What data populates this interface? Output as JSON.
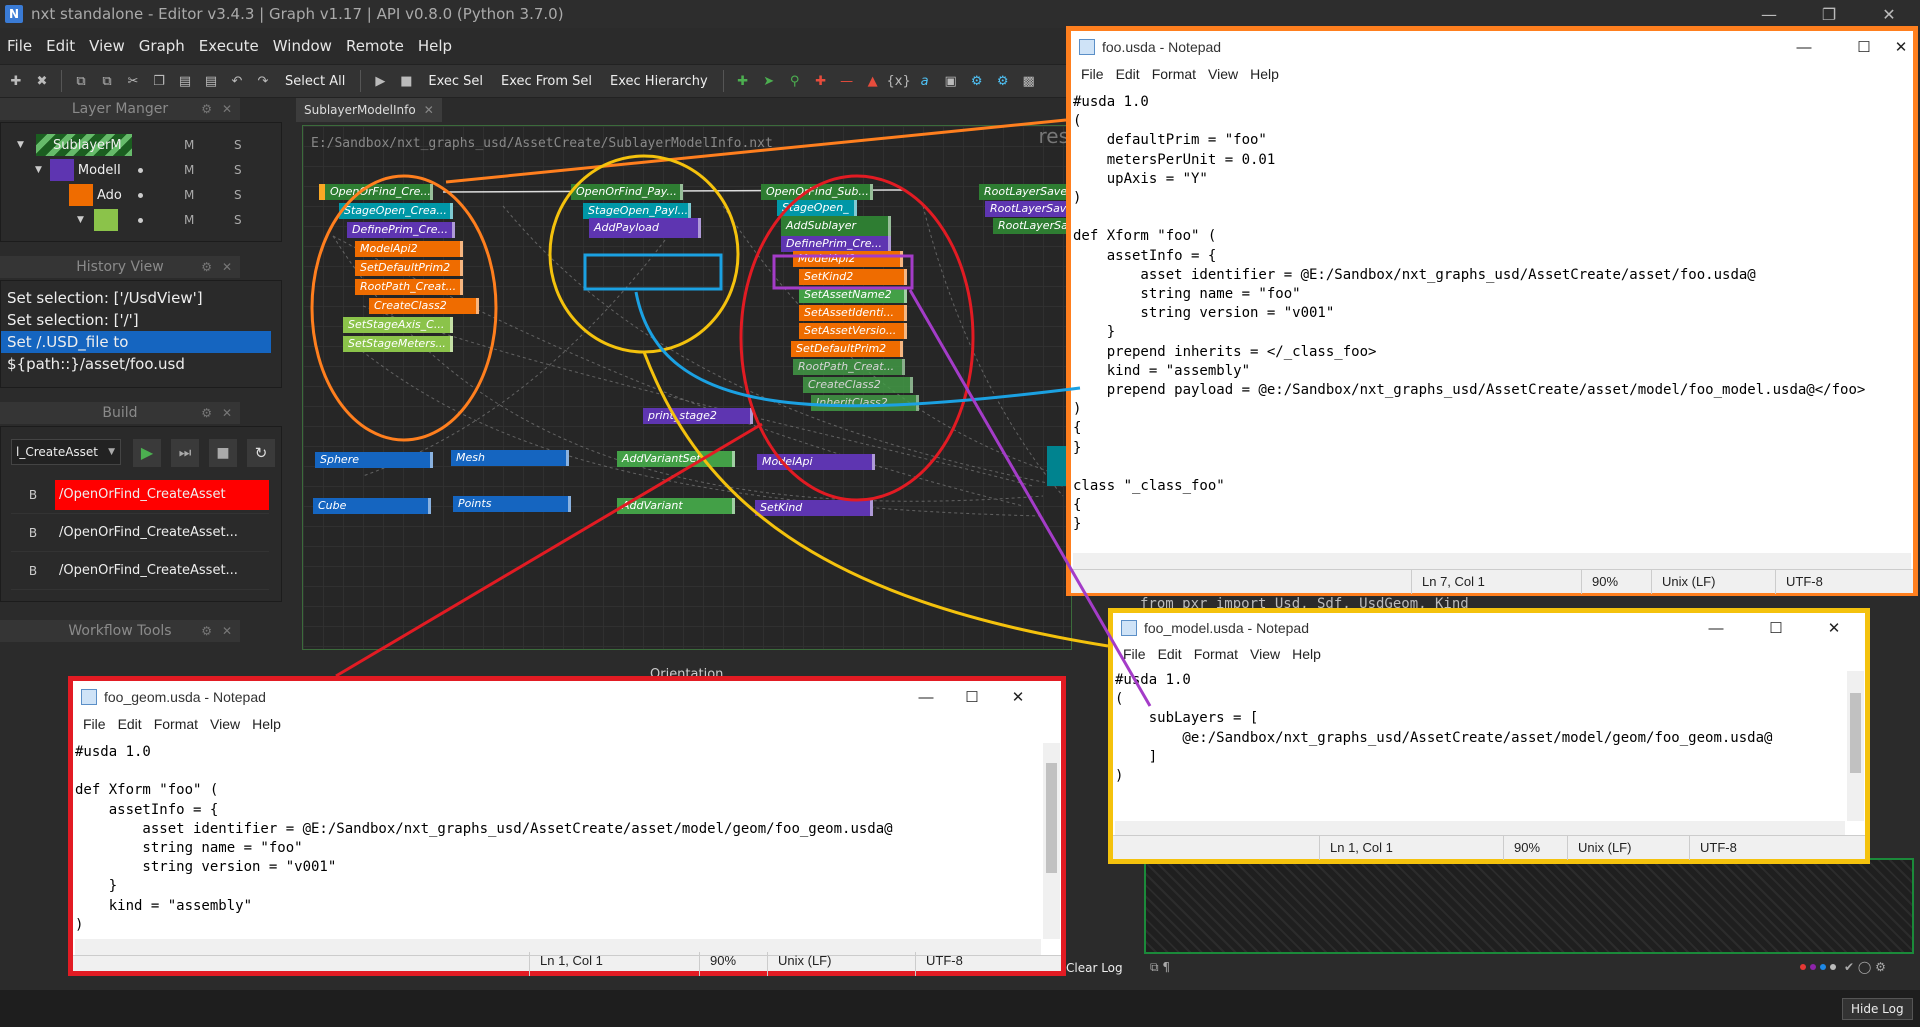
{
  "window": {
    "title": "nxt standalone - Editor v3.4.3 | Graph v1.17 | API v0.8.0 (Python 3.7.0)",
    "icon_letter": "N"
  },
  "menubar": [
    "File",
    "Edit",
    "View",
    "Graph",
    "Execute",
    "Window",
    "Remote",
    "Help"
  ],
  "toolbar": {
    "select_all": "Select All",
    "exec_sel": "Exec Sel",
    "exec_from_sel": "Exec From Sel",
    "exec_hierarchy": "Exec Hierarchy"
  },
  "layer_manager": {
    "title": "Layer Manger",
    "rows": [
      {
        "label": "SublayerM",
        "m": "M",
        "s": "S"
      },
      {
        "label": "ModelI",
        "m": "M",
        "s": "S"
      },
      {
        "label": "Ado",
        "m": "M",
        "s": "S"
      },
      {
        "label": "",
        "m": "M",
        "s": "S"
      }
    ]
  },
  "history_view": {
    "title": "History View",
    "items": [
      "Set selection: ['/UsdView']",
      "Set selection: ['/']",
      "Set /.USD_file to ${path::}/asset/foo.usd"
    ]
  },
  "build": {
    "title": "Build",
    "selected": "l_CreateAsset",
    "rows": [
      {
        "b": "B",
        "name": "/OpenOrFind_CreateAsset",
        "error": true
      },
      {
        "b": "B",
        "name": "/OpenOrFind_CreateAsset...",
        "error": false
      },
      {
        "b": "B",
        "name": "/OpenOrFind_CreateAsset...",
        "error": false
      }
    ]
  },
  "workflow_tools": {
    "title": "Workflow Tools"
  },
  "graph": {
    "tab": "SublayerModelInfo",
    "path": "E:/Sandbox/nxt_graphs_usd/AssetCreate/SublayerModelInfo.nxt",
    "corner_label": "res",
    "nodes": {
      "n1": "OpenOrFind_Cre...",
      "n2": "StageOpen_Crea...",
      "n3": "DefinePrim_Cre...",
      "n4": "ModelApi2",
      "n5": "SetDefaultPrim2",
      "n6": "RootPath_Creat...",
      "n7": "CreateClass2",
      "n8": "SetStageAxis_C...",
      "n9": "SetStageMeters...",
      "p1": "OpenOrFind_Pay...",
      "p2": "StageOpen_Payl...",
      "p3": "AddPayload",
      "s1": "OpenOrFind_Sub...",
      "s2": "StageOpen_",
      "s3": "AddSublayer",
      "s4": "DefinePrim_Cre...",
      "s5": "ModelApi2",
      "s6": "SetKind2",
      "s7": "SetAssetName2",
      "s8": "SetAssetIdenti...",
      "s9": "SetAssetVersio...",
      "s10": "SetDefaultPrim2",
      "s11": "RootPath_Creat...",
      "s12": "CreateClass2",
      "s13": "InheritClass2",
      "r1": "RootLayerSave",
      "r2": "RootLayerSav",
      "r3": "RootLayerSa",
      "print": "print_stage2",
      "sphere": "Sphere",
      "mesh": "Mesh",
      "addvariantset": "AddVariantSet",
      "modelapi": "ModelApi",
      "cube": "Cube",
      "points": "Points",
      "addvariant": "AddVariant",
      "setkind": "SetKind"
    }
  },
  "notepad_foo": {
    "title": "foo.usda - Notepad",
    "menu": [
      "File",
      "Edit",
      "Format",
      "View",
      "Help"
    ],
    "content": "#usda 1.0\n(\n    defaultPrim = \"foo\"\n    metersPerUnit = 0.01\n    upAxis = \"Y\"\n)\n\ndef Xform \"foo\" (\n    assetInfo = {\n        asset identifier = @E:/Sandbox/nxt_graphs_usd/AssetCreate/asset/foo.usda@\n        string name = \"foo\"\n        string version = \"v001\"\n    }\n    prepend inherits = </_class_foo>\n    kind = \"assembly\"\n    prepend payload = @e:/Sandbox/nxt_graphs_usd/AssetCreate/asset/model/foo_model.usda@</foo>\n)\n{\n}\n\nclass \"_class_foo\"\n{\n}",
    "status": {
      "pos": "Ln 7, Col 1",
      "zoom": "90%",
      "eol": "Unix (LF)",
      "enc": "UTF-8"
    }
  },
  "notepad_model": {
    "title": "foo_model.usda - Notepad",
    "menu": [
      "File",
      "Edit",
      "Format",
      "View",
      "Help"
    ],
    "content": "#usda 1.0\n(\n    subLayers = [\n        @e:/Sandbox/nxt_graphs_usd/AssetCreate/asset/model/geom/foo_geom.usda@\n    ]\n)",
    "status": {
      "pos": "Ln 1, Col 1",
      "zoom": "90%",
      "eol": "Unix (LF)",
      "enc": "UTF-8"
    }
  },
  "notepad_geom": {
    "title": "foo_geom.usda - Notepad",
    "menu": [
      "File",
      "Edit",
      "Format",
      "View",
      "Help"
    ],
    "content": "#usda 1.0\n\ndef Xform \"foo\" (\n    assetInfo = {\n        asset identifier = @E:/Sandbox/nxt_graphs_usd/AssetCreate/asset/model/geom/foo_geom.usda@\n        string name = \"foo\"\n        string version = \"v001\"\n    }\n    kind = \"assembly\"\n)",
    "status": {
      "pos": "Ln 1, Col 1",
      "zoom": "90%",
      "eol": "Unix (LF)",
      "enc": "UTF-8"
    }
  },
  "code_peek": "from pxr import Usd, Sdf, UsdGeom, Kind",
  "orientation_label": "Orientation",
  "clear_log": "Clear Log",
  "hide_log": "Hide Log",
  "colors": {
    "orange": "#ff7f1e",
    "yellow": "#f4c20d",
    "red": "#e21b23",
    "blue": "#1ba1e2",
    "magenta": "#a43cc8"
  }
}
